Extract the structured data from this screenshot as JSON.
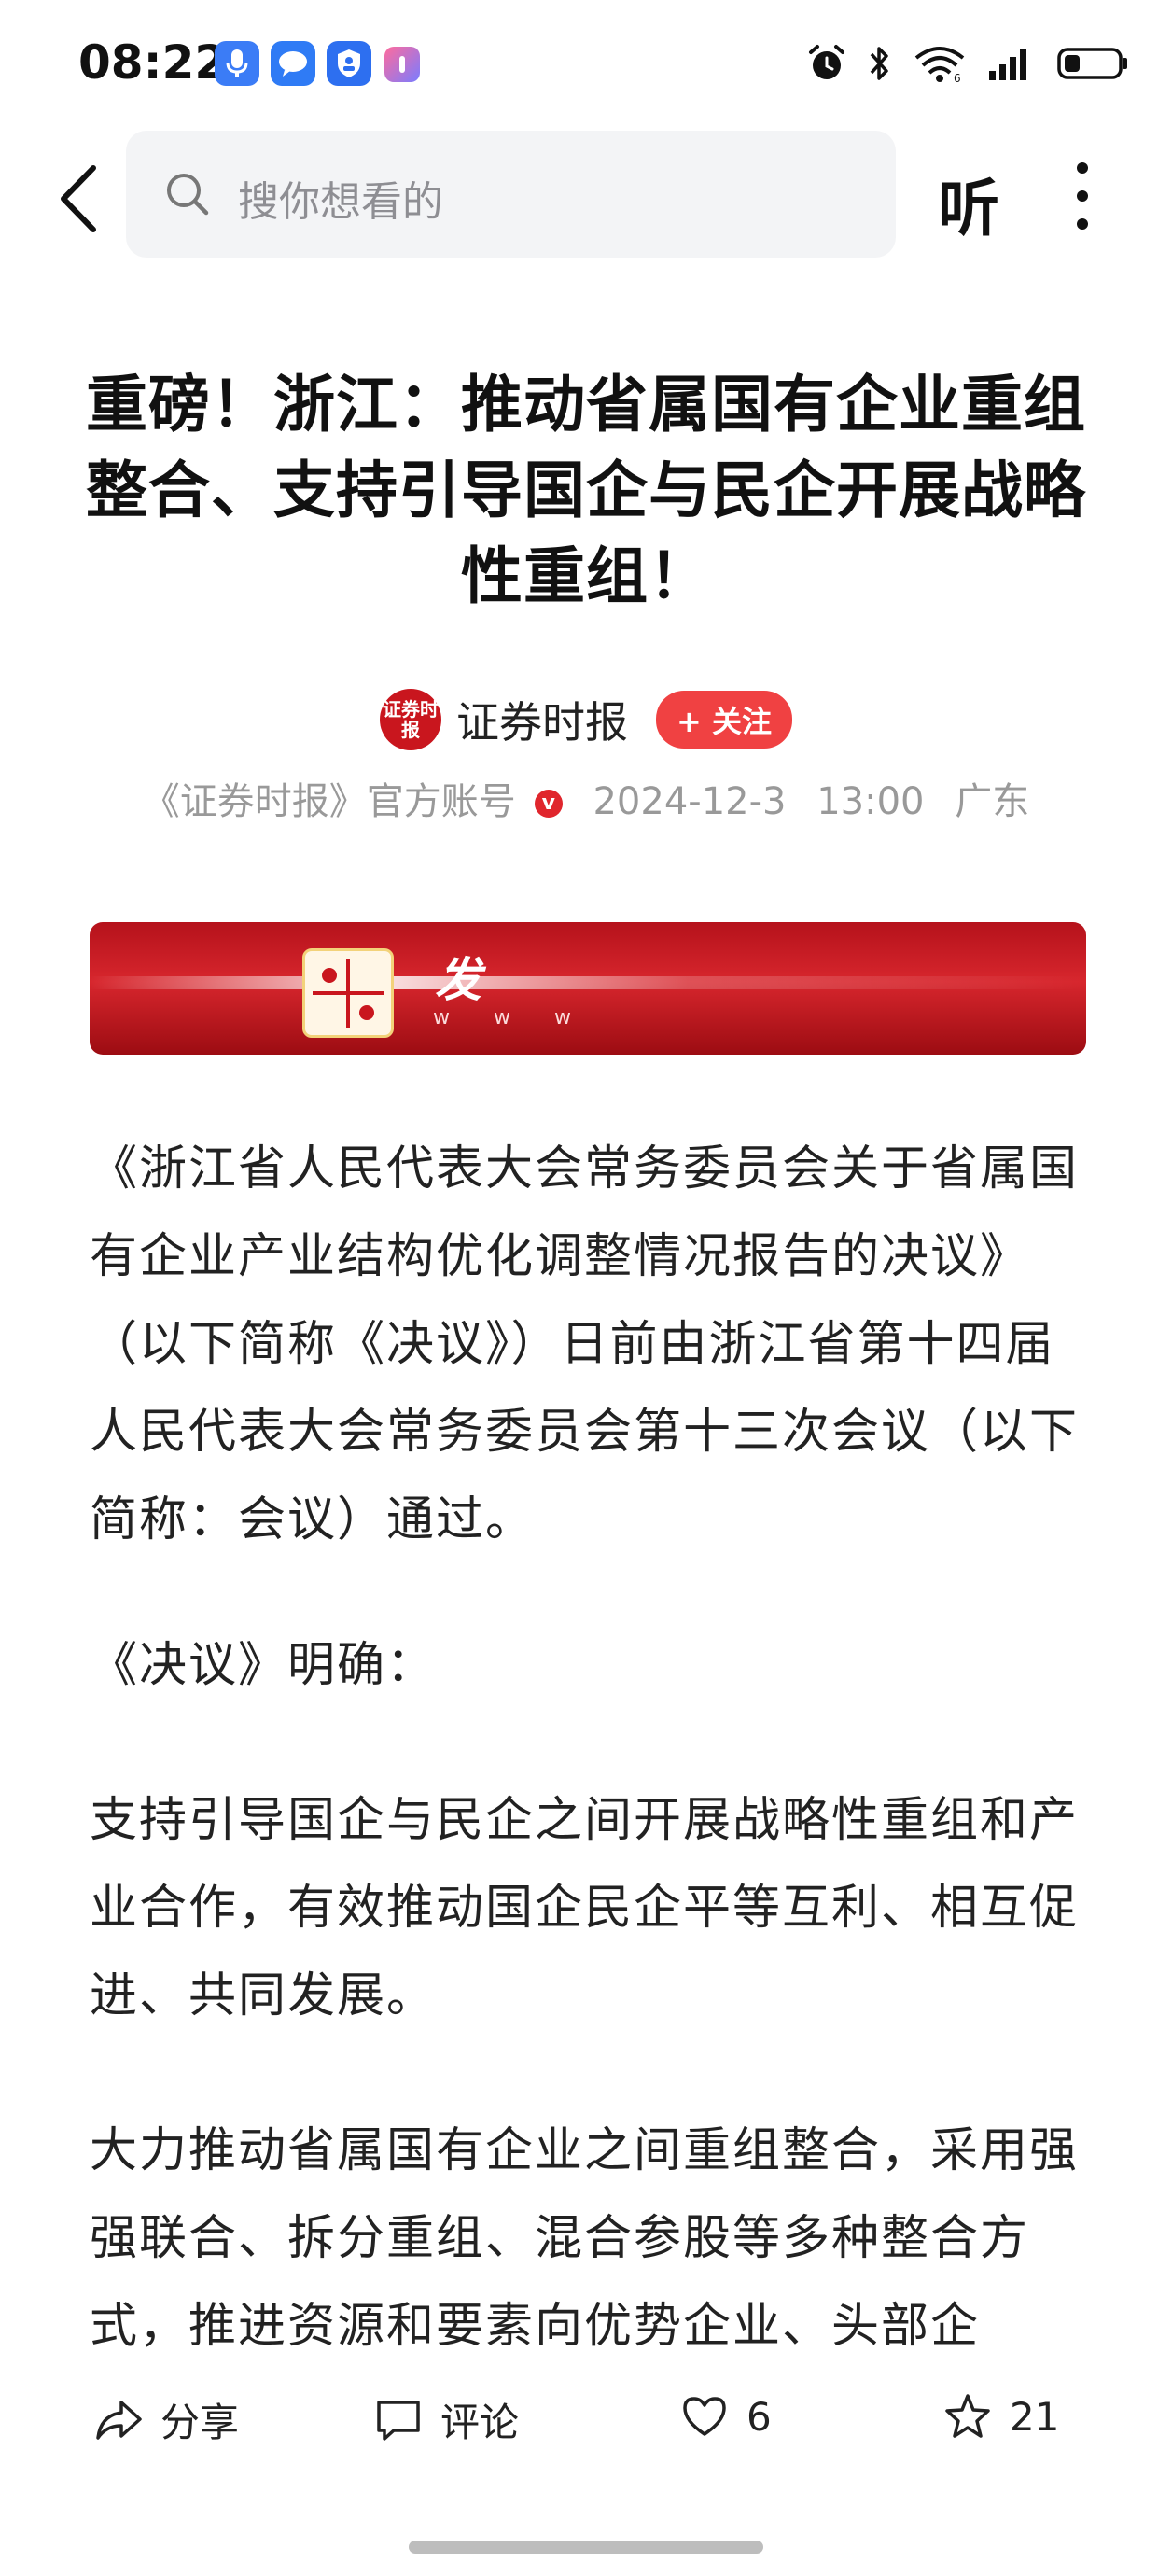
{
  "status_bar": {
    "time": "08:22",
    "notification_icons": [
      "microphone-icon",
      "message-icon",
      "shield-icon",
      "app-icon"
    ],
    "right_icons": [
      "alarm-icon",
      "bluetooth-icon",
      "wifi-icon",
      "signal-icon",
      "battery-icon"
    ]
  },
  "nav": {
    "search_placeholder": "搜你想看的",
    "listen_label": "听"
  },
  "article": {
    "title_lines": [
      "重磅！浙江：推动省属国有企业重组",
      "整合、支持引导国企与民企开展战略",
      "性重组！"
    ],
    "author": "证券时报",
    "author_logo_text": "证券时报",
    "follow_label": "+ 关注",
    "account_desc": "《证券时报》官方账号",
    "verified_badge": "v",
    "date": "2024-12-3",
    "time": "13:00",
    "location": "广东",
    "banner_text": "发",
    "banner_sub": "w w w",
    "paragraphs": [
      "《浙江省人民代表大会常务委员会关于省属国有企业产业结构优化调整情况报告的决议》（以下简称《决议》）日前由浙江省第十四届人民代表大会常务委员会第十三次会议（以下简称：会议）通过。",
      "《决议》明确：",
      "支持引导国企与民企之间开展战略性重组和产业合作，有效推动国企民企平等互利、相互促进、共同发展。",
      "大力推动省属国有企业之间重组整合，采用强强联合、拆分重组、混合参股等多种整合方式，推进资源和要素向优势企业、头部企"
    ]
  },
  "bottom_bar": {
    "share_label": "分享",
    "comment_label": "评论",
    "like_count": "6",
    "favorite_count": "21"
  }
}
